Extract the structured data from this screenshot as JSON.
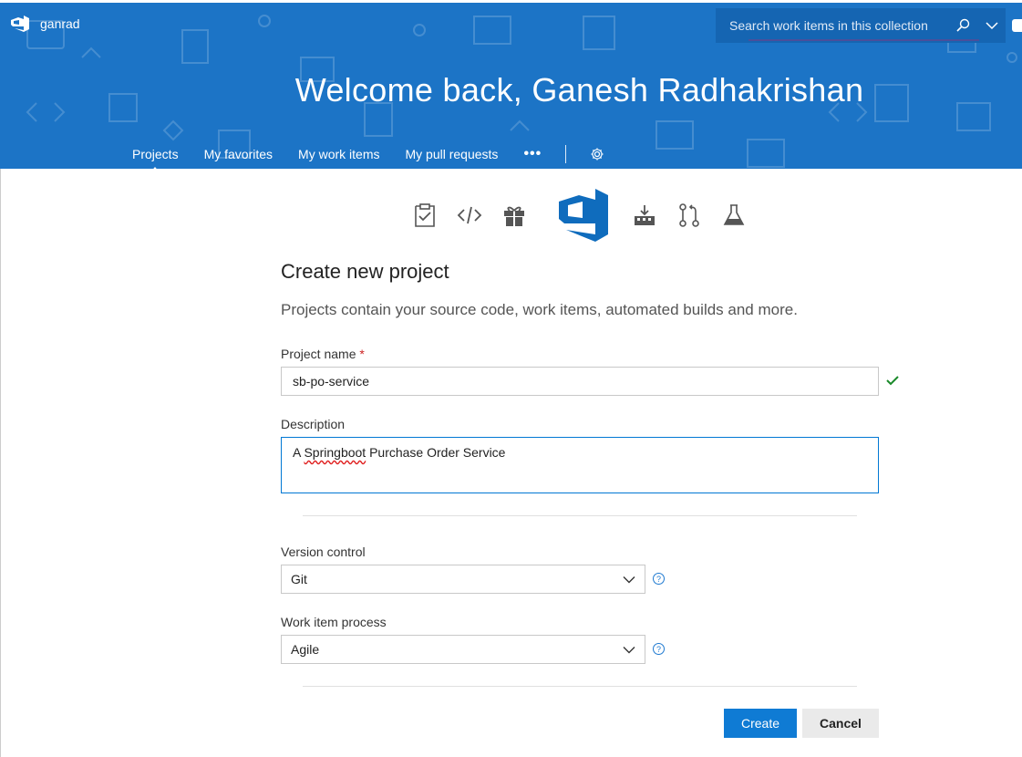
{
  "header": {
    "org_name": "ganrad",
    "welcome": "Welcome back, Ganesh Radhakrishan",
    "search": {
      "placeholder": "Search work items in this collection"
    },
    "nav": {
      "items": [
        {
          "label": "Projects",
          "active": true
        },
        {
          "label": "My favorites"
        },
        {
          "label": "My work items"
        },
        {
          "label": "My pull requests"
        }
      ],
      "more_label": "•••"
    },
    "colors": {
      "banner": "#1c74c6",
      "accent": "#0f7bd4"
    }
  },
  "service_icons": [
    "boards-icon",
    "code-icon",
    "artifacts-gift-icon",
    "vsts-logo-icon",
    "build-pipelines-icon",
    "pull-request-icon",
    "test-flask-icon"
  ],
  "form": {
    "title": "Create new project",
    "subtitle": "Projects contain your source code, work items, automated builds and more.",
    "project_name": {
      "label": "Project name",
      "required_marker": "*",
      "value": "sb-po-service"
    },
    "description": {
      "label": "Description",
      "value_prefix": "A ",
      "value_misspelled": "Springboot",
      "value_suffix": " Purchase Order Service"
    },
    "version_control": {
      "label": "Version control",
      "selected": "Git"
    },
    "work_item_process": {
      "label": "Work item process",
      "selected": "Agile"
    },
    "help_glyph": "?",
    "buttons": {
      "create": "Create",
      "cancel": "Cancel"
    }
  }
}
